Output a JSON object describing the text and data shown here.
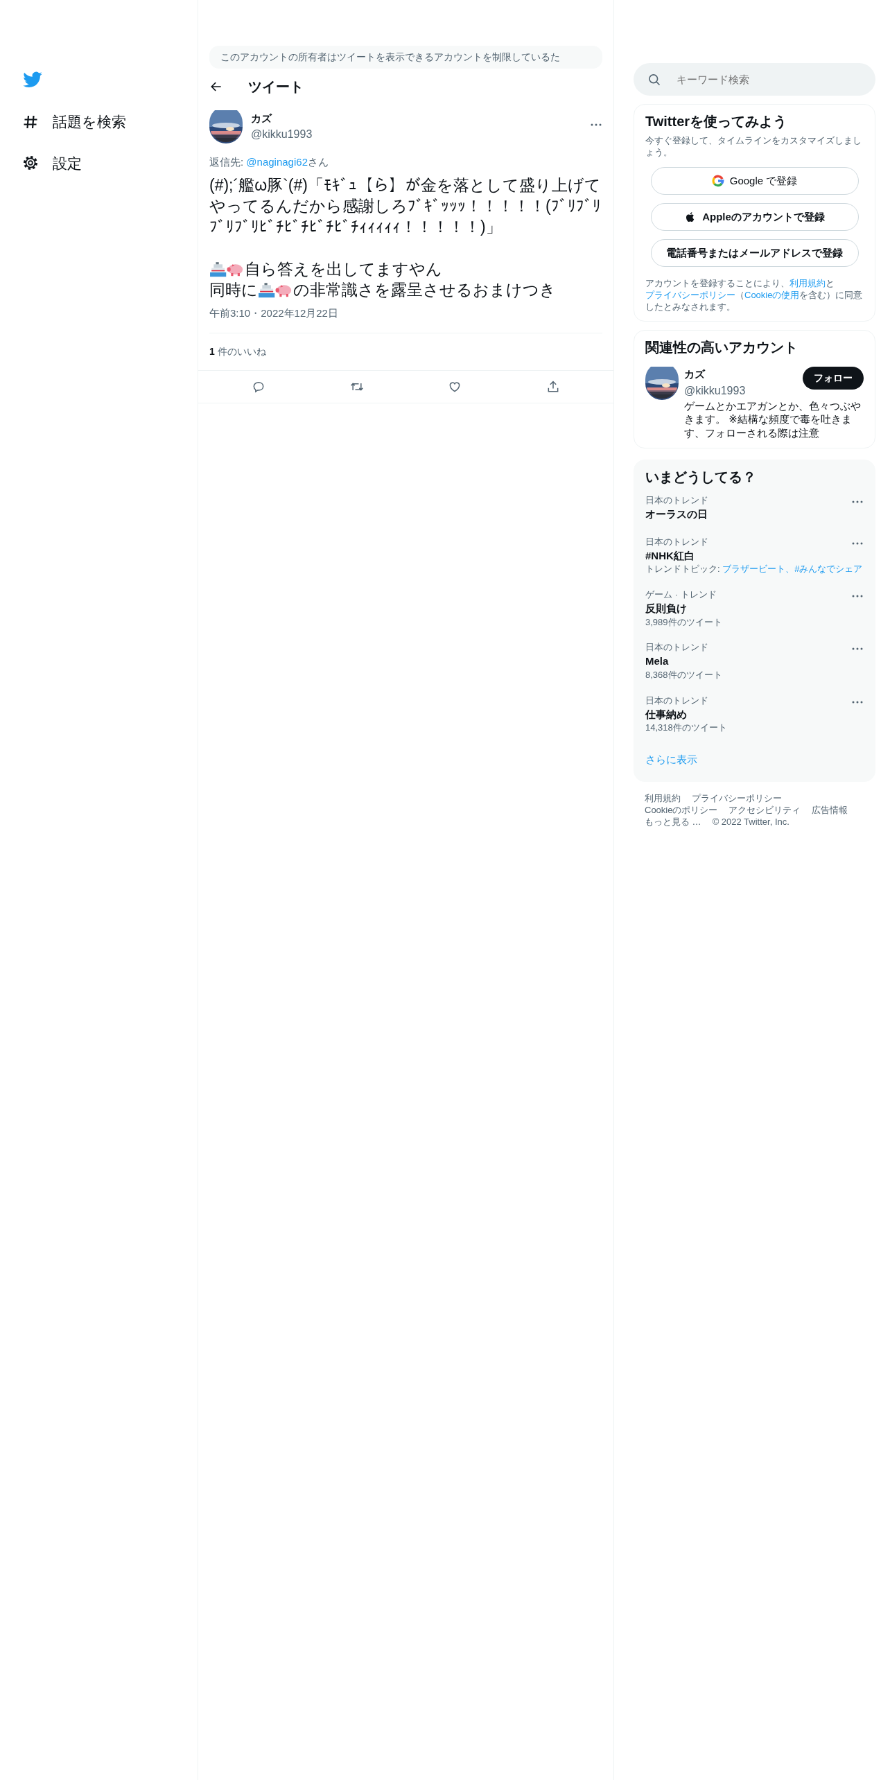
{
  "sidebar": {
    "items": [
      {
        "kind": "explore",
        "label": "話題を検索"
      },
      {
        "kind": "settings",
        "label": "設定"
      }
    ]
  },
  "notice": {
    "text": "このアカウントの所有者はツイートを表示できるアカウントを制限しているた"
  },
  "header": {
    "title": "ツイート"
  },
  "tweet": {
    "author": {
      "name": "カズ",
      "handle": "@kikku1993"
    },
    "reply_to": {
      "prefix": "返信先: ",
      "handle": "@naginagi62",
      "suffix": "さん"
    },
    "paragraphs": [
      {
        "lines": [
          [
            {
              "kind": "text",
              "text": "(#);´艦ω豚`(#)「ﾓｷﾞｭ【ら】が金を落として盛り上げてやってるんだから感謝しろﾌﾞｷﾞｯｯｯ！！！！！(ﾌﾞﾘﾌﾞﾘﾌﾞﾘﾌﾞﾘﾋﾞﾁﾋﾞﾁﾋﾞﾁﾋﾞﾁｨｨｨｨｨ！！！！！)」"
            }
          ]
        ]
      },
      {
        "lines": [
          [
            {
              "kind": "ship"
            },
            {
              "kind": "pig"
            },
            {
              "kind": "text",
              "text": "自ら答えを出してますやん"
            }
          ],
          [
            {
              "kind": "text",
              "text": "同時に"
            },
            {
              "kind": "ship"
            },
            {
              "kind": "pig"
            },
            {
              "kind": "text",
              "text": "の非常識さを露呈させるおまけつき"
            }
          ]
        ]
      }
    ],
    "timestamp": "午前3:10・2022年12月22日",
    "likes": {
      "count": "1",
      "label": "件のいいね"
    },
    "actions": [
      {
        "kind": "reply"
      },
      {
        "kind": "retweet"
      },
      {
        "kind": "like"
      },
      {
        "kind": "share"
      }
    ]
  },
  "search": {
    "placeholder": "キーワード検索"
  },
  "signup": {
    "title": "Twitterを使ってみよう",
    "subtitle": "今すぐ登録して、タイムラインをカスタマイズしましょう。",
    "buttons": [
      {
        "kind": "google",
        "label": "Google で登録"
      },
      {
        "kind": "apple",
        "label": "Appleのアカウントで登録"
      },
      {
        "kind": "plain",
        "label": "電話番号またはメールアドレスで登録"
      }
    ],
    "legal": [
      {
        "kind": "text",
        "text": "アカウントを登録することにより、"
      },
      {
        "kind": "link",
        "text": "利用規約"
      },
      {
        "kind": "text",
        "text": "と"
      },
      {
        "kind": "link",
        "text": "プライバシーポリシー"
      },
      {
        "kind": "text",
        "text": "（"
      },
      {
        "kind": "link",
        "text": "Cookieの使用"
      },
      {
        "kind": "text",
        "text": "を含む）に同意したとみなされます。"
      }
    ]
  },
  "related": {
    "title": "関連性の高いアカウント",
    "accounts": [
      {
        "name": "カズ",
        "handle": "@kikku1993",
        "follow_label": "フォロー",
        "bio": "ゲームとかエアガンとか、色々つぶやきます。 ※結構な頻度で毒を吐きます、フォローされる際は注意"
      }
    ]
  },
  "trends": {
    "title": "いまどうしてる？",
    "items": [
      {
        "context": "日本のトレンド",
        "title": "オーラスの日"
      },
      {
        "context": "日本のトレンド",
        "title": "#NHK紅白",
        "detail": [
          {
            "kind": "text",
            "text": "トレンドトピック: "
          },
          {
            "kind": "link",
            "text": "ブラザービート、#みんなでシェア"
          }
        ]
      },
      {
        "context": "ゲーム · トレンド",
        "title": "反則負け",
        "detail": [
          {
            "kind": "text",
            "text": "3,989件のツイート"
          }
        ]
      },
      {
        "context": "日本のトレンド",
        "title": "Mela",
        "detail": [
          {
            "kind": "text",
            "text": "8,368件のツイート"
          }
        ]
      },
      {
        "context": "日本のトレンド",
        "title": "仕事納め",
        "detail": [
          {
            "kind": "text",
            "text": "14,318件のツイート"
          }
        ]
      }
    ],
    "more": "さらに表示"
  },
  "footer": {
    "rows": [
      [
        "利用規約",
        "プライバシーポリシー"
      ],
      [
        "Cookieのポリシー",
        "アクセシビリティ",
        "広告情報"
      ],
      [
        "もっと見る …",
        "© 2022 Twitter, Inc."
      ]
    ]
  }
}
